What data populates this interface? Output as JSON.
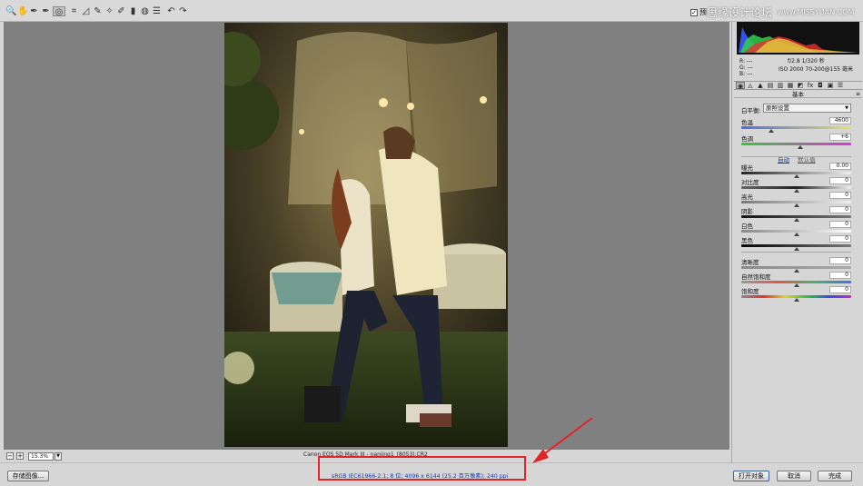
{
  "toolbar": {
    "tools": [
      {
        "name": "zoom-tool-icon",
        "glyph": "🔍"
      },
      {
        "name": "hand-tool-icon",
        "glyph": "✋"
      },
      {
        "name": "white-balance-tool-icon",
        "glyph": "✒"
      },
      {
        "name": "color-sampler-tool-icon",
        "glyph": "✒"
      },
      {
        "name": "targeted-adjustment-tool-icon",
        "glyph": "◎"
      },
      {
        "name": "crop-tool-icon",
        "glyph": "⌗"
      },
      {
        "name": "straighten-tool-icon",
        "glyph": "◿"
      },
      {
        "name": "spot-removal-tool-icon",
        "glyph": "✎"
      },
      {
        "name": "red-eye-tool-icon",
        "glyph": "✧"
      },
      {
        "name": "adjustment-brush-icon",
        "glyph": "✐"
      },
      {
        "name": "graduated-filter-icon",
        "glyph": "▮"
      },
      {
        "name": "radial-filter-icon",
        "glyph": "◍"
      },
      {
        "name": "preferences-icon",
        "glyph": "☰"
      },
      {
        "name": "rotate-left-icon",
        "glyph": "↶"
      },
      {
        "name": "rotate-right-icon",
        "glyph": "↷"
      }
    ],
    "preview_label": "预",
    "preview_checked": "✓"
  },
  "watermark": {
    "text": "思缘设计论坛",
    "url": "www.MISSYUAN.COM"
  },
  "readout": {
    "r": "R:  ---",
    "g": "G:  ---",
    "b": "B:  ---",
    "aperture_shutter": "f/2.8    1/320 秒",
    "iso_lens": "ISO 2000    70-200@155 毫米"
  },
  "panel_tabs": [
    "◉",
    "◬",
    "▲",
    "▤",
    "▥",
    "▦",
    "◩",
    "fx",
    "◘",
    "▣",
    "☰"
  ],
  "section": {
    "title": "基本",
    "menu_glyph": "≡"
  },
  "white_balance": {
    "label": "白平衡:",
    "value": "原照设置"
  },
  "auto_label": "自动",
  "default_label": "默认值",
  "sliders": [
    {
      "key": "temperature",
      "label": "色温",
      "value": "4600",
      "level": 0.27,
      "gradient": "linear-gradient(90deg,#4c6ce0,#e8e070)"
    },
    {
      "key": "tint",
      "label": "色调",
      "value": "+6",
      "level": 0.54,
      "gradient": "linear-gradient(90deg,#3ec23e,#d63ad6)"
    },
    {
      "key": "exposure",
      "label": "曝光",
      "value": "0.00",
      "level": 0.5,
      "gradient": "linear-gradient(90deg,#222,#f0f0f0)"
    },
    {
      "key": "contrast",
      "label": "对比度",
      "value": "0",
      "level": 0.5,
      "gradient": "linear-gradient(90deg,#666,#222,#f0f0f0)"
    },
    {
      "key": "highlights",
      "label": "高光",
      "value": "0",
      "level": 0.5,
      "gradient": "linear-gradient(90deg,#777,#f0f0f0)"
    },
    {
      "key": "shadows",
      "label": "阴影",
      "value": "0",
      "level": 0.5,
      "gradient": "linear-gradient(90deg,#111,#777)"
    },
    {
      "key": "whites",
      "label": "白色",
      "value": "0",
      "level": 0.5,
      "gradient": "linear-gradient(90deg,#888,#fff)"
    },
    {
      "key": "blacks",
      "label": "黑色",
      "value": "0",
      "level": 0.5,
      "gradient": "linear-gradient(90deg,#000,#777)"
    },
    {
      "key": "clarity",
      "label": "清晰度",
      "value": "0",
      "level": 0.5,
      "gradient": "linear-gradient(90deg,#888,#aaa)"
    },
    {
      "key": "vibrance",
      "label": "自然饱和度",
      "value": "0",
      "level": 0.5,
      "gradient": "linear-gradient(90deg,#999,#e0574a,#4ab26b,#4a6ee0)"
    },
    {
      "key": "saturation",
      "label": "饱和度",
      "value": "0",
      "level": 0.5,
      "gradient": "linear-gradient(90deg,#888,#e23030,#e0d030,#30c040,#3050e0,#c030c0)"
    }
  ],
  "zoom": {
    "minus": "−",
    "plus": "+",
    "value": "15.3%",
    "menu": "▼"
  },
  "filename": "Canon EOS 5D Mark III - nanjing1_(8053).CR2",
  "bottom": {
    "save_label": "存储图像...",
    "workflow_text": "sRGB IEC61966-2.1; 8 位; 4096 x 6144 (25.2 百万像素); 240 ppi",
    "open_label": "打开对象",
    "cancel_label": "取消",
    "done_label": "完成"
  },
  "colors": {
    "annotation": "#e2232a",
    "link": "#1a3aa8",
    "canvas": "#808080"
  }
}
